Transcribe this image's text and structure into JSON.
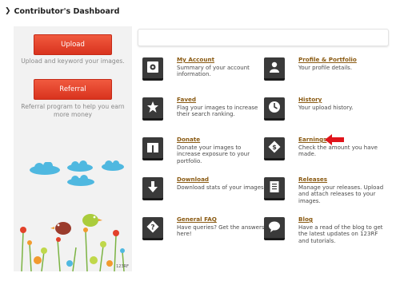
{
  "header": {
    "title": "Contributor's Dashboard"
  },
  "sidebar": {
    "upload_label": "Upload",
    "upload_text": "Upload and keyword your images.",
    "referral_label": "Referral",
    "referral_text": "Referral program to help you earn more money",
    "watermark": "123RF"
  },
  "items": [
    {
      "title": "My Account",
      "desc": "Summary of your account information.",
      "icon": "safe-icon"
    },
    {
      "title": "Profile & Portfolio",
      "desc": "Your profile details.",
      "icon": "user-icon"
    },
    {
      "title": "Faved",
      "desc": "Flag your images to increase their search ranking.",
      "icon": "star-icon"
    },
    {
      "title": "History",
      "desc": "Your upload history.",
      "icon": "clock-icon"
    },
    {
      "title": "Donate",
      "desc": "Donate your images to increase exposure to your portfolio.",
      "icon": "gift-icon"
    },
    {
      "title": "Earnings",
      "desc": "Check the amount you have made.",
      "icon": "dollar-icon"
    },
    {
      "title": "Download",
      "desc": "Download stats of your images.",
      "icon": "download-icon"
    },
    {
      "title": "Releases",
      "desc": "Manage your releases. Upload and attach releases to your images.",
      "icon": "document-icon"
    },
    {
      "title": "General FAQ",
      "desc": "Have queries? Get the answers here!",
      "icon": "question-icon"
    },
    {
      "title": "Blog",
      "desc": "Have a read of the blog to get the latest updates on 123RF and tutorials.",
      "icon": "speech-bubble-icon"
    }
  ],
  "colors": {
    "accent": "#e2412a",
    "link": "#8a5a12",
    "icon_bg": "#3a3a3a"
  }
}
